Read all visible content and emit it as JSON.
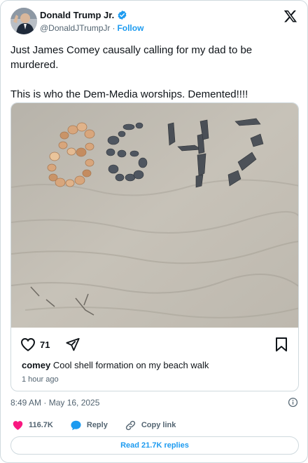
{
  "author": {
    "display_name": "Donald Trump Jr.",
    "handle": "@DonaldJTrumpJr",
    "separator": "·",
    "follow_label": "Follow"
  },
  "tweet": {
    "line1": "Just James Comey causally calling for my dad to be murdered.",
    "line2": "This is who the Dem-Media worships. Demented!!!!"
  },
  "embed": {
    "likes": "71",
    "username": "comey",
    "caption": "Cool shell formation on my beach walk",
    "time_ago": "1 hour ago"
  },
  "timestamp": "8:49 AM · May 16, 2025",
  "actions": {
    "likes_count": "116.7K",
    "reply_label": "Reply",
    "copy_link_label": "Copy link"
  },
  "read_replies_label": "Read 21.7K replies",
  "colors": {
    "accent": "#1d9bf0",
    "like_pink": "#f91880",
    "text_secondary": "#536471",
    "border": "#cfd9de"
  },
  "icons": [
    "verified-badge-icon",
    "x-logo-icon",
    "heart-outline-icon",
    "send-icon",
    "bookmark-icon",
    "info-icon",
    "heart-filled-icon",
    "reply-bubble-icon",
    "link-icon"
  ]
}
